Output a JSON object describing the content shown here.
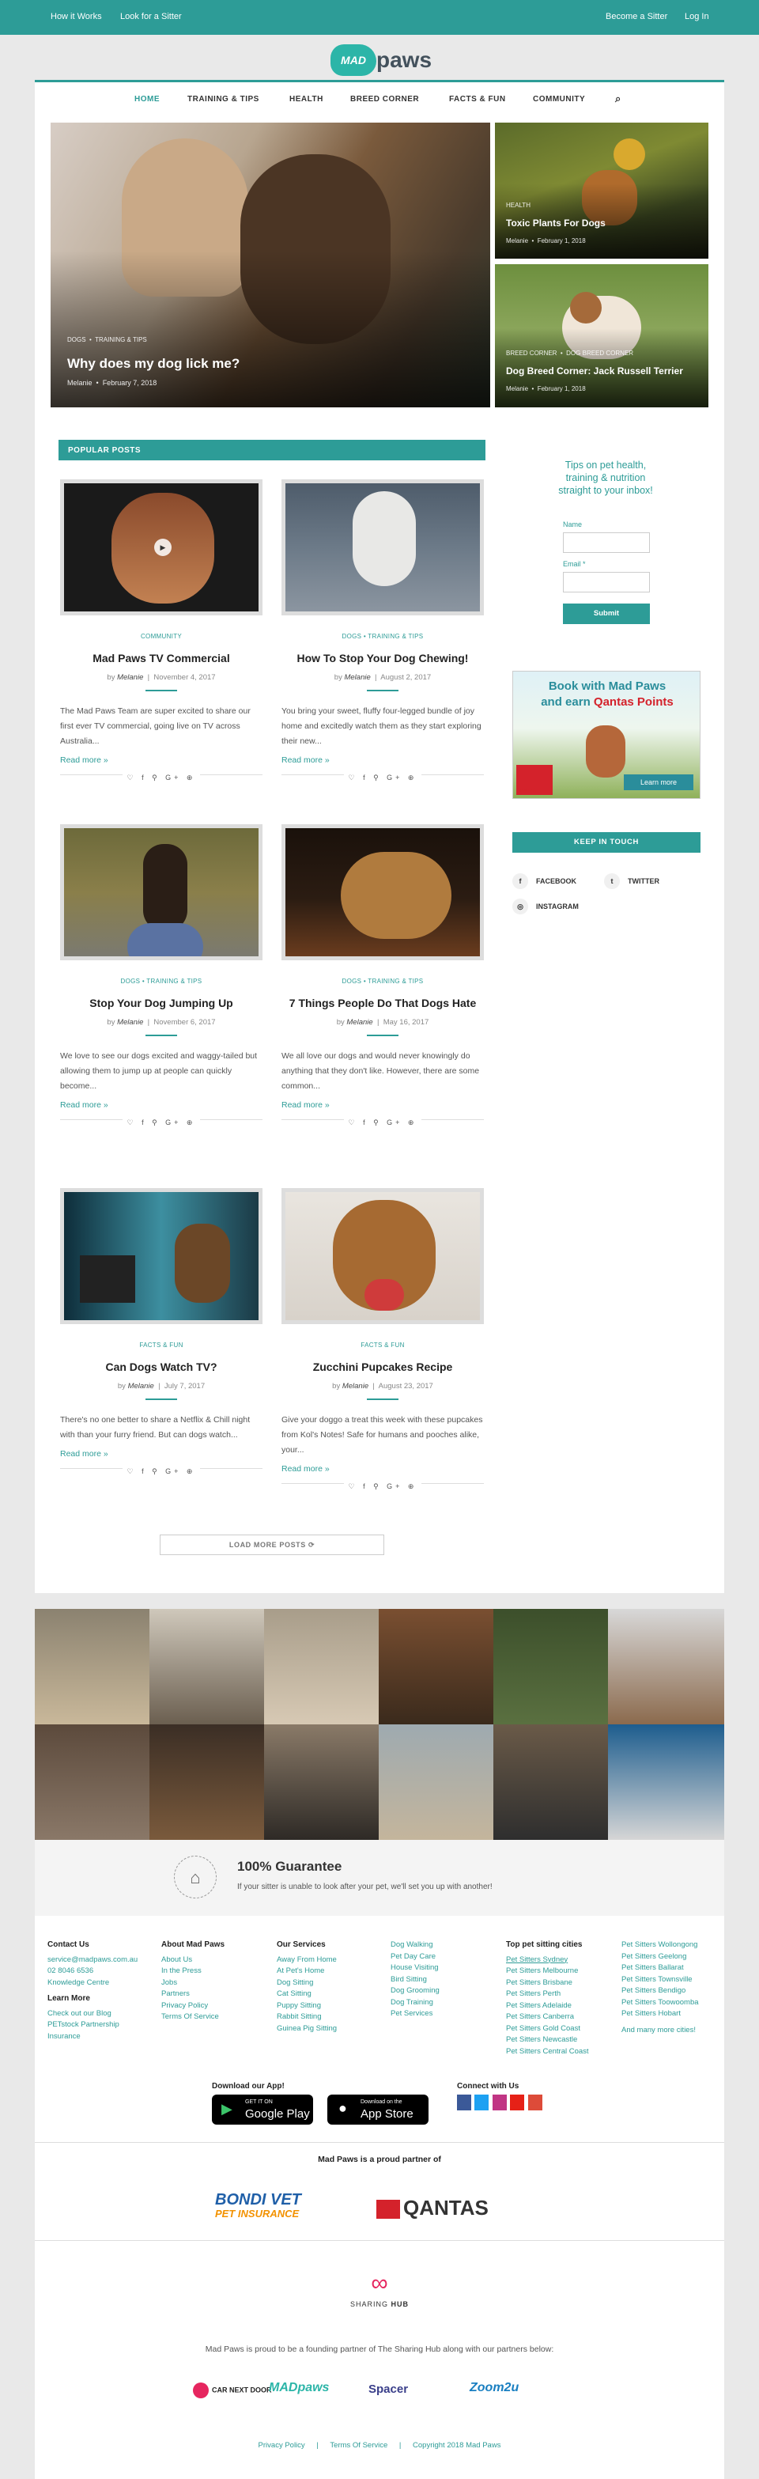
{
  "topbar": {
    "left": [
      "How it Works",
      "Look for a Sitter"
    ],
    "right": [
      "Become a Sitter",
      "Log In"
    ]
  },
  "logo": {
    "blob": "MAD",
    "word": "paws"
  },
  "nav": {
    "items": [
      "HOME",
      "TRAINING & TIPS",
      "HEALTH",
      "BREED CORNER",
      "FACTS & FUN",
      "COMMUNITY"
    ],
    "search_icon": "search-icon"
  },
  "hero": {
    "main": {
      "cat1": "DOGS",
      "cat2": "TRAINING & TIPS",
      "title": "Why does my dog lick me?",
      "author": "Melanie",
      "date": "February 7, 2018"
    },
    "top": {
      "cat": "HEALTH",
      "title": "Toxic Plants For Dogs",
      "author": "Melanie",
      "date": "February 1, 2018"
    },
    "bottom": {
      "cat1": "BREED CORNER",
      "cat2": "DOG BREED CORNER",
      "title": "Dog Breed Corner: Jack Russell Terrier",
      "author": "Melanie",
      "date": "February 1, 2018"
    }
  },
  "popular": {
    "heading": "POPULAR POSTS",
    "by": "by",
    "read_more": "Read more »",
    "share": "♡ f ⚲ G+ ⊕"
  },
  "posts": [
    {
      "cats": "COMMUNITY",
      "title": "Mad Paws TV Commercial",
      "author": "Melanie",
      "date": "November 4, 2017",
      "excerpt": "The Mad Paws Team are super excited to share our first ever TV commercial, going live on TV across Australia..."
    },
    {
      "cats": "DOGS  •  TRAINING & TIPS",
      "title": "How To Stop Your Dog Chewing!",
      "author": "Melanie",
      "date": "August 2, 2017",
      "excerpt": "You bring your sweet, fluffy four-legged bundle of joy home and excitedly watch them as they start exploring their new..."
    },
    {
      "cats": "DOGS  •  TRAINING & TIPS",
      "title": "Stop Your Dog Jumping Up",
      "author": "Melanie",
      "date": "November 6, 2017",
      "excerpt": "We love to see our dogs excited and waggy-tailed but allowing them to jump up at people can quickly become..."
    },
    {
      "cats": "DOGS  •  TRAINING & TIPS",
      "title": "7 Things People Do That Dogs Hate",
      "author": "Melanie",
      "date": "May 16, 2017",
      "excerpt": "We all love our dogs and would never knowingly do anything that they don't like. However, there are some common..."
    },
    {
      "cats": "FACTS & FUN",
      "title": "Can Dogs Watch TV?",
      "author": "Melanie",
      "date": "July 7, 2017",
      "excerpt": "There's no one better to share a Netflix & Chill night with than your furry friend. But can dogs watch..."
    },
    {
      "cats": "FACTS & FUN",
      "title": "Zucchini Pupcakes Recipe",
      "author": "Melanie",
      "date": "August 23, 2017",
      "excerpt": "Give your doggo a treat this week with these pupcakes from Kol's Notes! Safe for humans and pooches alike, your..."
    }
  ],
  "load_more": "LOAD MORE POSTS  ⟳",
  "sidebar": {
    "tips": "Tips on pet health, training & nutrition straight to your inbox!",
    "name_label": "Name",
    "email_label": "Email *",
    "submit": "Submit",
    "ad": {
      "line1": "Book with Mad Paws",
      "line2a": "and earn ",
      "line2b": "Qantas Points",
      "brand": "QANTAS",
      "cta": "Learn more"
    },
    "keep": "KEEP IN TOUCH",
    "social": [
      {
        "icon": "f",
        "label": "FACEBOOK"
      },
      {
        "icon": "t",
        "label": "TWITTER"
      },
      {
        "icon": "◎",
        "label": "INSTAGRAM"
      }
    ]
  },
  "guarantee": {
    "title": "100% Guarantee",
    "text": "If your sitter is unable to look after your pet, we'll set you up with another!"
  },
  "footer": {
    "contact": {
      "h": "Contact Us",
      "items": [
        "service@madpaws.com.au",
        "02 8046 6536",
        "Knowledge Centre"
      ]
    },
    "learn": {
      "h": "Learn More",
      "items": [
        "Check out our Blog",
        "PETstock Partnership",
        "Insurance"
      ]
    },
    "about": {
      "h": "About Mad Paws",
      "items": [
        "About Us",
        "In the Press",
        "Jobs",
        "Partners",
        "Privacy Policy",
        "Terms Of Service"
      ]
    },
    "services": {
      "h": "Our Services",
      "items": [
        "Away From Home",
        "At Pet's Home",
        "Dog Sitting",
        "Cat Sitting",
        "Puppy Sitting",
        "Rabbit Sitting",
        "Guinea Pig Sitting"
      ]
    },
    "services2": {
      "items": [
        "Dog Walking",
        "Pet Day Care",
        "House Visiting",
        "Bird Sitting",
        "Dog Grooming",
        "Dog Training",
        "Pet Services"
      ]
    },
    "cities": {
      "h": "Top pet sitting cities",
      "items": [
        "Pet Sitters Sydney",
        "Pet Sitters Melbourne",
        "Pet Sitters Brisbane",
        "Pet Sitters Perth",
        "Pet Sitters Adelaide",
        "Pet Sitters Canberra",
        "Pet Sitters Gold Coast",
        "Pet Sitters Newcastle",
        "Pet Sitters Central Coast"
      ]
    },
    "cities2": {
      "items": [
        "Pet Sitters Wollongong",
        "Pet Sitters Geelong",
        "Pet Sitters Ballarat",
        "Pet Sitters Townsville",
        "Pet Sitters Bendigo",
        "Pet Sitters Toowoomba",
        "Pet Sitters Hobart",
        "",
        "And many more cities!"
      ]
    },
    "app": {
      "h": "Download our App!",
      "gp1": "GET IT ON",
      "gp2": "Google Play",
      "as1": "Download on the",
      "as2": "App Store"
    },
    "connect": {
      "h": "Connect with Us"
    },
    "partner_h": "Mad Paws is a proud partner of",
    "bondi1": "BONDI VET",
    "bondi2": "PET INSURANCE",
    "qantas": "QANTAS",
    "hub1": "SHARING",
    "hub2": "HUB",
    "founding": "Mad Paws is proud to be a founding partner of The Sharing Hub along with our partners below:",
    "partners": [
      "CAR NEXT DOOR",
      "MADpaws",
      "Spacer",
      "Zoom2u"
    ],
    "links": [
      "Privacy Policy",
      "|",
      "Terms Of Service",
      "|",
      "Copyright 2018 Mad Paws"
    ]
  }
}
